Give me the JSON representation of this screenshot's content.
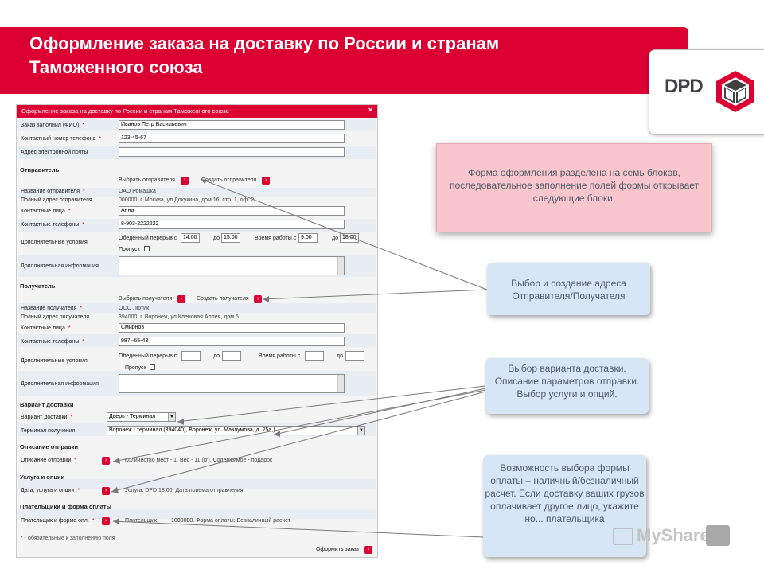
{
  "banner": {
    "title_line1": "Оформление заказа на доставку по России и странам",
    "title_line2": "Таможенного союза"
  },
  "logo": {
    "text": "DPD"
  },
  "form": {
    "header": "Оформление заказа на доставку по России и странам Таможенного союза",
    "close": "×",
    "filled_by_label": "Заказ заполнил (ФИО)",
    "filled_by_value": "Иванов Петр Васильевич",
    "contact_phone_label": "Контактный номер телефона",
    "contact_phone_value": "123-45-67",
    "email_label": "Адрес электронной почты",
    "sender": {
      "section": "Отправитель",
      "choose": "Выбрать отправителя",
      "create": "Создать отправителя",
      "name_label": "Название отправителя",
      "name_value": "ОАО Ромашка",
      "address_label": "Полный адрес отправителя",
      "address_value": "000000, г. Москва, ул Докукина, дом 16, стр. 1, оф. 2",
      "contact_label": "Контактные лица",
      "contact_value": "Анна",
      "phones_label": "Контактные телефоны",
      "phones_value": "8-903-2222222",
      "extra_label": "Дополнительные условия",
      "lunch_label": "Обеденный перерыв с",
      "to_label": "до",
      "lunch_from": "14:00",
      "lunch_to": "15:00",
      "work_label": "Время работы с",
      "work_from": "9:00",
      "work_to": "18:00",
      "pass_label": "Пропуск",
      "info_label": "Дополнительная информация"
    },
    "receiver": {
      "section": "Получатель",
      "choose": "Выбрать получателя",
      "create": "Создать получателя",
      "name_label": "Название получателя",
      "name_value": "ООО Лютик",
      "address_label": "Полный адрес получателя",
      "address_value": "394000, г. Воронеж, ул Кленовая Аллея, дом 5",
      "contact_label": "Контактные лица",
      "contact_value": "Смирнов",
      "phones_label": "Контактные телефоны",
      "phones_value": "987--65-43",
      "extra_label": "Дополнительные условия",
      "lunch_label": "Обеденный перерыв с",
      "to_label": "до",
      "work_label": "Время работы с",
      "pass_label": "Пропуск",
      "info_label": "Дополнительная информация"
    },
    "delivery": {
      "section": "Вариант доставки",
      "variant_label": "Вариант доставки",
      "variant_value": "Дверь - Терминал",
      "terminal_label": "Терминал получения",
      "terminal_value": "Воронеж - терминал (394040), Воронеж, ул. Мазлумова, д. 25а,)"
    },
    "description": {
      "section": "Описание отправки",
      "label": "Описание отправки",
      "value": "Количество мест - 1, Вес - 11 (кг), Содержимое - подарок"
    },
    "service": {
      "section": "Услуга и опции",
      "label": "Дата, услуга и опции",
      "value": "Услуга: DPD 18:00. Дата приема отправления:"
    },
    "payment": {
      "section": "Плательщики и форма оплаты",
      "label": "Плательщик и форма опл.",
      "payer_label": "Плательщик:",
      "value": "1000000. Форма оплаты: Безналичный расчет"
    },
    "required_note": "* - обязательные к заполнению поля",
    "submit": "Оформить заказ",
    "required_mark": "*",
    "btn_glyph": "›"
  },
  "callouts": {
    "main": "Форма оформления разделена на семь блоков, последовательное заполнение полей формы открывает следующие блоки.",
    "address": "Выбор и создание адреса Отправителя/Получателя",
    "delivery": "Выбор варианта доставки. Описание параметров отправки. Выбор услуги и опций.",
    "payment": "Возможность выбора формы оплаты – наличный/безналичный расчет. Если доставку ваших грузов оплачивает другое лицо, укажите но... плательщика"
  },
  "watermark": {
    "text": "MyShared"
  },
  "colors": {
    "brand_red": "#dc0032",
    "callout_blue": "#d6e6f4",
    "callout_pink": "#f8c6cc"
  }
}
